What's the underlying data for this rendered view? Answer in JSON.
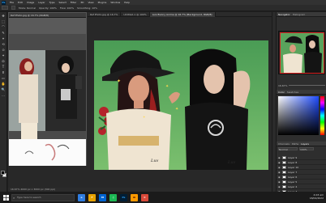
{
  "menubar": {
    "logo": "Ps",
    "items": [
      "File",
      "Edit",
      "Image",
      "Layer",
      "Type",
      "Select",
      "Filter",
      "3D",
      "View",
      "Plugins",
      "Window",
      "Help"
    ]
  },
  "options": {
    "mode_label": "Mode: Normal",
    "opacity_label": "Opacity: 100%",
    "flow_label": "Flow: 100%",
    "smoothing_label": "Smoothing: 10%"
  },
  "tools": [
    "✥",
    "⬚",
    "⌒",
    "✎",
    "⌖",
    "⟲",
    "⊙",
    "✦",
    "⬭",
    "T",
    "⬆",
    "▭",
    "✋",
    "🔍",
    "…"
  ],
  "documents": {
    "left_tab": "Ref Photo.jpg @ 16.7% (RGB/8)",
    "main_tabs": [
      {
        "label": "Ref Photo.jpg @ 16.7%"
      },
      {
        "label": "Untitled-1 @ 100%"
      },
      {
        "label": "Luis Bunny Anime @ 16.7% (Background, RGB/8)"
      }
    ]
  },
  "status_bar": "16.67%   4000 px x 3000 px (300 ppi)",
  "canvas_signature": "Luv",
  "right_panel": {
    "navigator_tabs": [
      "Navigator",
      "Histogram"
    ],
    "zoom": "16.67%",
    "color_tabs": [
      "Color",
      "Swatches"
    ],
    "layers_tabs": [
      "Layers",
      "Channels",
      "Paths"
    ],
    "blend_mode": "Normal",
    "opacity": "100%",
    "layers": [
      {
        "name": "Layer 9"
      },
      {
        "name": "Layer 8"
      },
      {
        "name": "Layer 10"
      },
      {
        "name": "Layer 7"
      },
      {
        "name": "Layer 6"
      },
      {
        "name": "Layer 5"
      },
      {
        "name": "Layer 4"
      },
      {
        "name": "Layer 3"
      },
      {
        "name": "Background"
      }
    ]
  },
  "taskbar": {
    "search_placeholder": "Type here to search",
    "apps": [
      {
        "label": "e",
        "color": "#2f7de1"
      },
      {
        "label": "F",
        "color": "#e8a300"
      },
      {
        "label": "M",
        "color": "#0064d2"
      },
      {
        "label": "♫",
        "color": "#1db954"
      },
      {
        "label": "Ps",
        "color": "#001e36"
      },
      {
        "label": "Ai",
        "color": "#ff9a00"
      },
      {
        "label": "C",
        "color": "#d94a3a"
      }
    ],
    "time": "4:03 am",
    "date": "18/02/2022"
  },
  "colors": {
    "canvas_bg_top": "#4a9c55",
    "canvas_bg_bottom": "#7bbf6e",
    "accent": "#31a8ff"
  }
}
